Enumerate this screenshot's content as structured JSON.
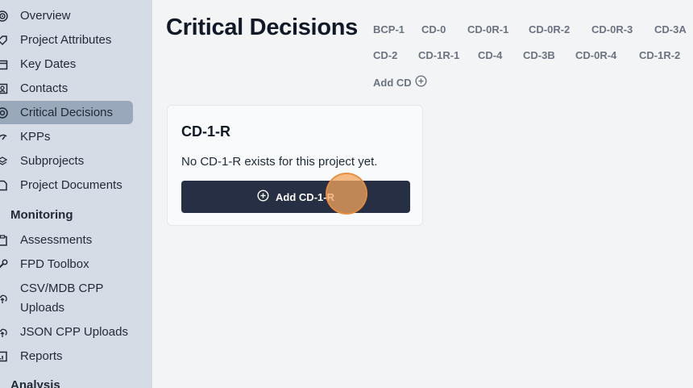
{
  "sidebar": {
    "items": [
      {
        "label": "Overview",
        "icon": "target-icon"
      },
      {
        "label": "Project Attributes",
        "icon": "tag-icon"
      },
      {
        "label": "Key Dates",
        "icon": "calendar-icon"
      },
      {
        "label": "Contacts",
        "icon": "contact-card-icon"
      },
      {
        "label": "Critical Decisions",
        "icon": "decision-icon"
      },
      {
        "label": "KPPs",
        "icon": "gauge-icon"
      },
      {
        "label": "Subprojects",
        "icon": "stack-icon"
      },
      {
        "label": "Project Documents",
        "icon": "document-icon"
      }
    ],
    "monitoring_title": "Monitoring",
    "monitoring_items": [
      {
        "label": "Assessments",
        "icon": "clipboard-icon"
      },
      {
        "label": "FPD Toolbox",
        "icon": "wrench-icon"
      },
      {
        "label": "CSV/MDB CPP",
        "label2": "Uploads",
        "icon": "cloud-upload-icon"
      },
      {
        "label": "JSON CPP Uploads",
        "icon": "cloud-upload-icon"
      },
      {
        "label": "Reports",
        "icon": "report-icon"
      }
    ],
    "analysis_title": "Analysis"
  },
  "main": {
    "title": "Critical Decisions",
    "tabs_row1": [
      "BCP-1",
      "CD-0",
      "CD-0R-1",
      "CD-0R-2",
      "CD-0R-3",
      "CD-3A"
    ],
    "tabs_row2": [
      "CD-2",
      "CD-1R-1",
      "CD-4",
      "CD-3B",
      "CD-0R-4",
      "CD-1R-2"
    ],
    "add_cd_label": "Add CD"
  },
  "card": {
    "title": "CD-1-R",
    "message": "No CD-1-R exists for this project yet.",
    "button_label": "Add CD-1-R"
  },
  "colors": {
    "sidebar_bg": "#d5dce5",
    "active_item_bg": "#9aa8bb",
    "button_bg": "#262f44",
    "cursor": "#f3a45c"
  }
}
